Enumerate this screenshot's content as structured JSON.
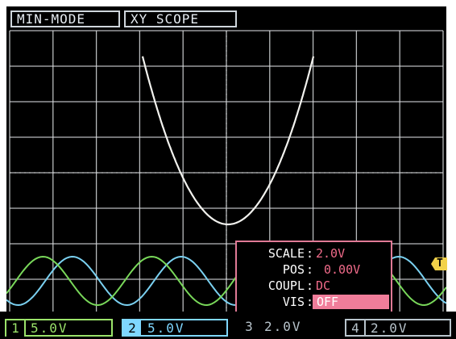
{
  "header": {
    "mode_label": "MIN-MODE",
    "scope_label": "XY SCOPE"
  },
  "channel_panel": {
    "rows": [
      {
        "label": "SCALE",
        "value": "2.0V"
      },
      {
        "label": "POS",
        "value": "0.00V"
      },
      {
        "label": "COUPL",
        "value": "DC"
      },
      {
        "label": "VIS",
        "value": "OFF"
      }
    ]
  },
  "trigger": {
    "label": "T"
  },
  "channels": [
    {
      "number": "1",
      "value": "5.0V",
      "color": "#9be36a",
      "active": true
    },
    {
      "number": "2",
      "value": "5.0V",
      "color": "#7fd7ff",
      "active": true
    },
    {
      "number": "3",
      "value": "2.0V",
      "color": "#b8c4cc",
      "active": false
    },
    {
      "number": "4",
      "value": "2.0V",
      "color": "#b8c4cc",
      "active": false
    }
  ],
  "colors": {
    "grid": "#d9dcde",
    "xy_trace": "#f2f2ee",
    "ch1_trace": "#79d85a",
    "ch2_trace": "#7ad0f0",
    "panel_accent": "#f07d9a",
    "trigger": "#f2d24a"
  }
}
